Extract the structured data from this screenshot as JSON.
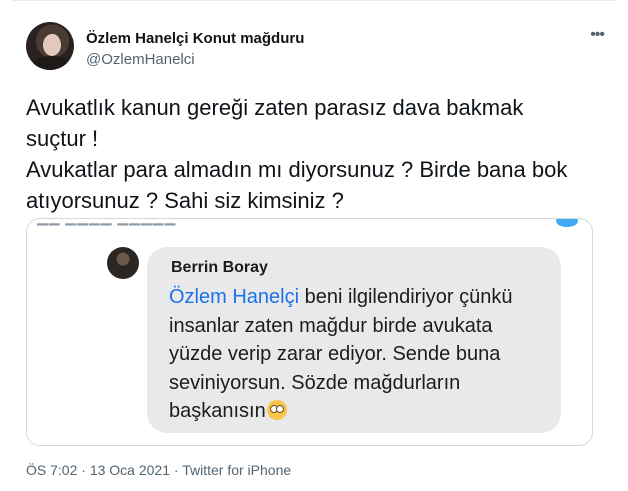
{
  "author": {
    "display_name": "Özlem Hanelçi Konut mağduru",
    "handle": "@OzlemHanelci",
    "avatar_icon": "profile-photo"
  },
  "tweet": {
    "lines": [
      "Avukatlık kanun gereği zaten parasız dava bakmak",
      "suçtur !",
      "Avukatlar para almadın mı diyorsunuz ? Birde bana bok",
      "atıyorsunuz ? Sahi siz kimsiniz ?"
    ]
  },
  "screenshot": {
    "commenter_name": "Berrin Boray",
    "mention": "Özlem Hanelçi",
    "lines": [
      " beni ilgilendiriyor çünkü",
      "insanlar zaten mağdur birde avukata",
      "yüzde verip zarar ediyor. Sende buna",
      "seviniyorsun. Sözde mağdurların",
      "başkanısın"
    ],
    "emoji_icon": "face-with-rolling-eyes-icon"
  },
  "meta": {
    "time": "ÖS 7:02",
    "separator": "·",
    "date": "13 Oca 2021",
    "source": "Twitter for iPhone"
  },
  "colors": {
    "mention": "#1a73e8",
    "bubble": "#e9e9eb",
    "secondary_text": "#536471"
  }
}
